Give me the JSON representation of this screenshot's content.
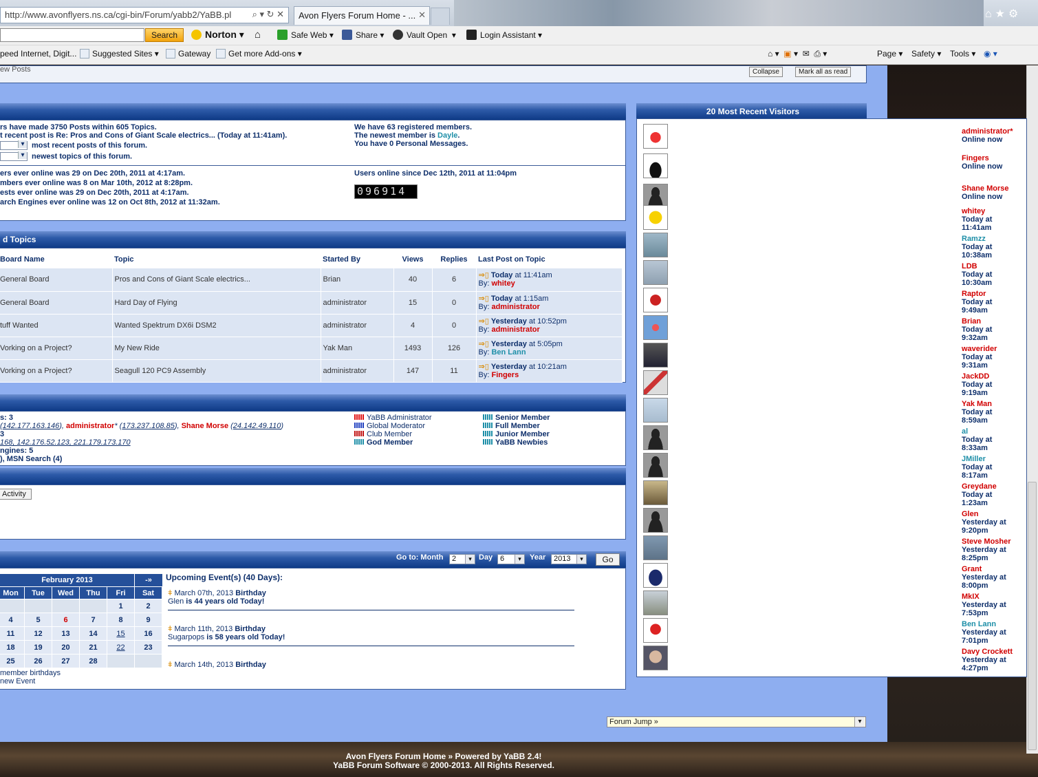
{
  "browser": {
    "address": "http://www.avonflyers.ns.ca/cgi-bin/Forum/yabb2/YaBB.pl",
    "tab_title": "Avon Flyers Forum Home - ...",
    "search_button": "Search",
    "toolbar": [
      "Norton",
      "Safe Web",
      "Share",
      "Vault Open",
      "Login Assistant"
    ],
    "favorites": [
      "peed Internet, Digit...",
      "Suggested Sites",
      "Gateway",
      "Get more Add-ons"
    ],
    "commands": [
      "Page",
      "Safety",
      "Tools"
    ]
  },
  "topbar": {
    "new_posts": "ew Posts",
    "collapse": "Collapse",
    "mark_read": "Mark all as read"
  },
  "stats": {
    "line1": "rs have made 3750 Posts within 605 Topics.",
    "line2": "t recent post is Re: Pros and Cons of Giant Scale electrics... (Today at 11:41am).",
    "line3": "most recent posts of this forum.",
    "line4": "newest topics of this forum.",
    "members1": "We have 63 registered members.",
    "members2_prefix": "The newest member is ",
    "newest_member": "Dayle",
    "members3": "You have 0 Personal Messages.",
    "rec1": "ers ever online was 29 on Dec 20th, 2011 at 4:17am.",
    "rec2": "mbers ever online was 8 on Mar 10th, 2012 at 8:28pm.",
    "rec3": "ests ever online was 29 on Dec 20th, 2011 at 4:17am.",
    "rec4": "arch Engines ever online was 12 on Oct 8th, 2012 at 11:32am.",
    "since": "Users online since Dec 12th, 2011 at 11:04pm",
    "counter": "096914"
  },
  "recent_topics": {
    "title": "d Topics",
    "headers": [
      "Board Name",
      "Topic",
      "Started By",
      "Views",
      "Replies",
      "Last Post on Topic"
    ],
    "rows": [
      {
        "board": "General Board",
        "topic": "Pros and Cons of Giant Scale electrics...",
        "by": "Brian",
        "views": "40",
        "replies": "6",
        "when_b": "Today",
        "when": " at 11:41am",
        "last": "whitey",
        "last_color": "red"
      },
      {
        "board": "General Board",
        "topic": "Hard Day of Flying",
        "by": "administrator",
        "views": "15",
        "replies": "0",
        "when_b": "Today",
        "when": " at 1:15am",
        "last": "administrator",
        "last_color": "red"
      },
      {
        "board": "tuff Wanted",
        "topic": "Wanted Spektrum DX6i DSM2",
        "by": "administrator",
        "views": "4",
        "replies": "0",
        "when_b": "Yesterday",
        "when": " at 10:52pm",
        "last": "administrator",
        "last_color": "red"
      },
      {
        "board": "Vorking on a Project?",
        "topic": "My New Ride",
        "by": "Yak Man",
        "views": "1493",
        "replies": "126",
        "when_b": "Yesterday",
        "when": " at 5:05pm",
        "last": "Ben Lann",
        "last_color": "teal"
      },
      {
        "board": "Vorking on a Project?",
        "topic": "Seagull 120 PC9 Assembly",
        "by": "administrator",
        "views": "147",
        "replies": "11",
        "when_b": "Yesterday",
        "when": " at 10:21am",
        "last": "Fingers",
        "last_color": "red"
      }
    ],
    "by_label": "By:"
  },
  "online": {
    "count": "s: 3",
    "ip1": "142.177.163.146",
    "admin": "administrator",
    "ip2": "173.237.108.85",
    "shane": "Shane Morse",
    "ip3": "24.142.49.110",
    "guests": "168, 142.176.52.123, 221.179.173.170",
    "guest_prefix": "3",
    "engines": "ngines: 5",
    "msn": "), MSN Search  (4)",
    "legend": [
      {
        "label": "YaBB Administrator",
        "color": "#e01010"
      },
      {
        "label": "Global Moderator",
        "color": "#2040c0"
      },
      {
        "label": "Club Member",
        "color": "#c01010"
      },
      {
        "label": "God Member",
        "color": "#1e8fa8"
      },
      {
        "label": "Senior Member",
        "color": "#1e8fa8"
      },
      {
        "label": "Full Member",
        "color": "#1e8fa8"
      },
      {
        "label": "Junior Member",
        "color": "#1e8fa8"
      },
      {
        "label": "YaBB Newbies",
        "color": "#1e8fa8"
      }
    ]
  },
  "activity_button": "Activity",
  "calendar": {
    "goto": "Go to: Month",
    "month_val": "2",
    "day_label": "Day",
    "day_val": "6",
    "year_label": "Year",
    "year_val": "2013",
    "go": "Go",
    "title": "February 2013",
    "next": "-»",
    "days": [
      "Mon",
      "Tue",
      "Wed",
      "Thu",
      "Fri",
      "Sat"
    ],
    "weeks": [
      [
        "",
        "",
        "",
        "",
        "1",
        "2"
      ],
      [
        "4",
        "5",
        "6",
        "7",
        "8",
        "9"
      ],
      [
        "11",
        "12",
        "13",
        "14",
        "15",
        "16"
      ],
      [
        "18",
        "19",
        "20",
        "21",
        "22",
        "23"
      ],
      [
        "25",
        "26",
        "27",
        "28",
        "",
        ""
      ]
    ],
    "member_birthdays": "member birthdays",
    "new_event": "new Event",
    "upcoming": "Upcoming Event(s) (40 Days):",
    "events": [
      {
        "date": "March 07th, 2013",
        "type": "Birthday",
        "name": "Glen",
        "desc": " is 44 years old Today!"
      },
      {
        "date": "March 11th, 2013",
        "type": "Birthday",
        "name": "Sugarpops",
        "desc": " is 58 years old Today!"
      },
      {
        "date": "March 14th, 2013",
        "type": "Birthday",
        "name": "",
        "desc": ""
      }
    ]
  },
  "visitors": {
    "title": "20 Most Recent Visitors",
    "list": [
      {
        "name": "administrator*",
        "time": "Online now",
        "color": "red",
        "avatar": "plane-cartoon"
      },
      {
        "name": "Fingers",
        "time": "Online now",
        "color": "red",
        "avatar": "hand"
      },
      {
        "name": "Shane Morse",
        "time": "Online now",
        "color": "red",
        "avatar": "silhouette"
      },
      {
        "name": "whitey",
        "time": "Today at 11:41am",
        "color": "red",
        "avatar": "homer"
      },
      {
        "name": "Ramzz",
        "time": "Today at 10:38am",
        "color": "teal",
        "avatar": "jet"
      },
      {
        "name": "LDB",
        "time": "Today at 10:30am",
        "color": "red",
        "avatar": "plane"
      },
      {
        "name": "Raptor",
        "time": "Today at 9:49am",
        "color": "red",
        "avatar": "robot"
      },
      {
        "name": "Brian",
        "time": "Today at 9:32am",
        "color": "red",
        "avatar": "aerobat"
      },
      {
        "name": "waverider",
        "time": "Today at 9:31am",
        "color": "red",
        "avatar": "plane-dark"
      },
      {
        "name": "JackDD",
        "time": "Today at 9:19am",
        "color": "red",
        "avatar": "jet-red"
      },
      {
        "name": "Yak Man",
        "time": "Today at 8:59am",
        "color": "red",
        "avatar": "plane-sky"
      },
      {
        "name": "al",
        "time": "Today at 8:33am",
        "color": "teal",
        "avatar": "silhouette"
      },
      {
        "name": "JMiller",
        "time": "Today at 8:17am",
        "color": "teal",
        "avatar": "silhouette"
      },
      {
        "name": "Greydane",
        "time": "Today at 1:23am",
        "color": "red",
        "avatar": "photo"
      },
      {
        "name": "Glen",
        "time": "Yesterday at 9:20pm",
        "color": "red",
        "avatar": "silhouette"
      },
      {
        "name": "Steve Mosher",
        "time": "Yesterday at 8:25pm",
        "color": "red",
        "avatar": "plane-red"
      },
      {
        "name": "Grant",
        "time": "Yesterday at 8:00pm",
        "color": "red",
        "avatar": "batman"
      },
      {
        "name": "MkIX",
        "time": "Yesterday at 7:53pm",
        "color": "red",
        "avatar": "field"
      },
      {
        "name": "Ben Lann",
        "time": "Yesterday at 7:01pm",
        "color": "teal",
        "avatar": "woody"
      },
      {
        "name": "Davy Crockett",
        "time": "Yesterday at 4:27pm",
        "color": "red",
        "avatar": "face"
      }
    ]
  },
  "forum_jump": "Forum Jump »",
  "footer": {
    "line1": "Avon Flyers Forum Home » Powered by YaBB 2.4!",
    "line2": "YaBB Forum Software © 2000-2013. All Rights Reserved."
  }
}
